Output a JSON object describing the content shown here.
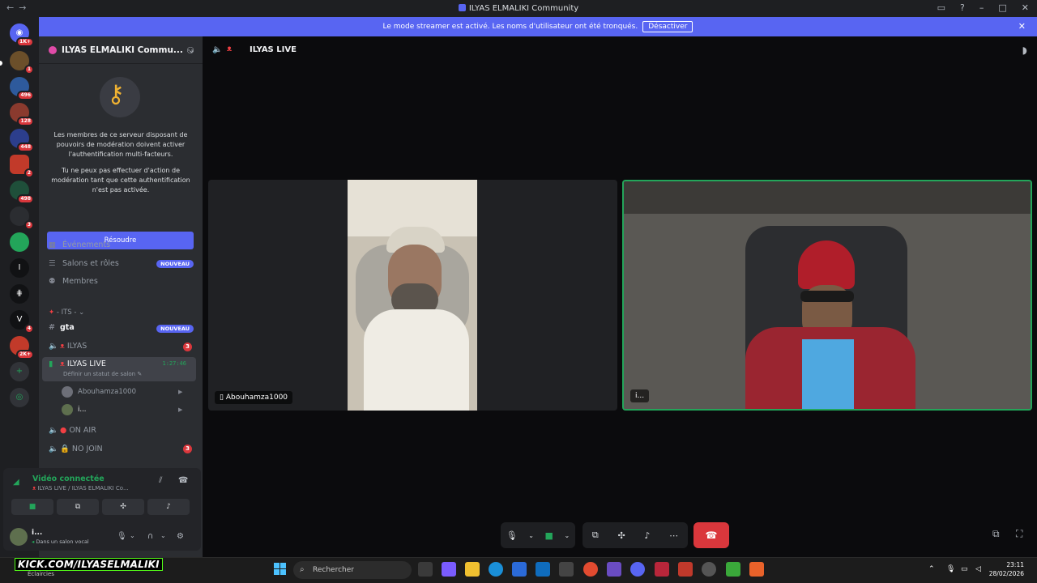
{
  "window": {
    "title": "ILYAS ELMALIKI Community",
    "back": "←",
    "forward": "→"
  },
  "banner": {
    "text": "Le mode streamer est activé. Les noms d'utilisateur ont été tronqués.",
    "button": "Désactiver"
  },
  "rail": {
    "badges": [
      "1K+",
      "1",
      "496",
      "128",
      "448",
      "2",
      "498",
      "3",
      "4",
      "2K+"
    ],
    "letters": [
      "I",
      "V"
    ]
  },
  "server": {
    "name": "ILYAS ELMALIKI Commu..."
  },
  "mfa": {
    "text1": "Les membres de ce serveur disposant de pouvoirs de modération doivent activer l'authentification multi-facteurs.",
    "text2": "Tu ne peux pas effectuer d'action de modération tant que cette authentification n'est pas activée.",
    "button": "Résoudre"
  },
  "nav": {
    "events": "Événements",
    "roles": "Salons et rôles",
    "roles_badge": "NOUVEAU",
    "members": "Membres"
  },
  "category": "- ITS -",
  "channels": {
    "gta": "gta",
    "gta_badge": "NOUVEAU",
    "ilyas": "ILYAS",
    "ilyas_badge": "3",
    "live": "ILYAS LIVE",
    "live_timer": "1:27:46",
    "live_status": "Définir un statut de salon",
    "members": [
      "Abouhamza1000",
      "i..."
    ],
    "onair": "ON AIR",
    "nojoin": "NO JOIN",
    "nojoin_badge": "3"
  },
  "voice": {
    "status": "Vidéo connectée",
    "location": "ILYAS LIVE / ILYAS ELMALIKI Co..."
  },
  "user": {
    "name": "i...",
    "status": "Dans un salon vocal"
  },
  "header": {
    "channel": "ILYAS LIVE"
  },
  "tiles": [
    {
      "name": "Abouhamza1000"
    },
    {
      "name": "i..."
    }
  ],
  "taskbar": {
    "kick": "KICK.COM/ILYASELMALIKI",
    "weather": "Éclaircies",
    "search": "Rechercher",
    "time": "23:11",
    "date": "28/02/2026"
  },
  "colors": {
    "accent": "#5865f2",
    "green": "#23a55a",
    "red": "#da373c"
  }
}
